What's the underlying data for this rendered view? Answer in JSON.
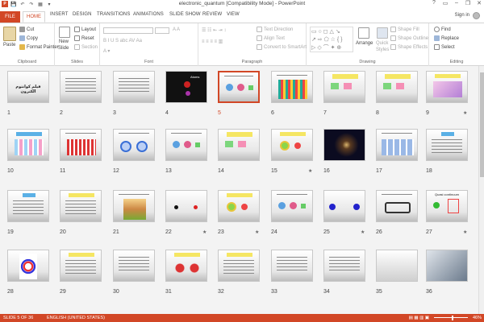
{
  "window": {
    "title": "electronic_quantum [Compatibility Mode] - PowerPoint",
    "controls": [
      "?",
      "▭",
      "–",
      "❐",
      "✕"
    ]
  },
  "qat": [
    "P",
    "💾",
    "↶",
    "↷",
    "▦",
    "▾"
  ],
  "tabs": {
    "file": "FILE",
    "home": "HOME",
    "items": [
      "INSERT",
      "DESIGN",
      "TRANSITIONS",
      "ANIMATIONS",
      "SLIDE SHOW",
      "REVIEW",
      "VIEW"
    ],
    "signin": "Sign in"
  },
  "ribbon": {
    "clipboard": {
      "label": "Clipboard",
      "paste": "Paste",
      "cut": "Cut",
      "copy": "Copy",
      "format_painter": "Format Painter"
    },
    "slides": {
      "label": "Slides",
      "new_slide": "New",
      "new_slide2": "Slide",
      "layout": "Layout",
      "reset": "Reset",
      "section": "Section"
    },
    "font": {
      "label": "Font"
    },
    "paragraph": {
      "label": "Paragraph",
      "text_direction": "Text Direction",
      "align_text": "Align Text",
      "convert": "Convert to SmartArt"
    },
    "drawing": {
      "label": "Drawing",
      "arrange": "Arrange",
      "quick_styles": "Quick",
      "quick_styles2": "Styles",
      "shape_fill": "Shape Fill",
      "shape_outline": "Shape Outline",
      "shape_effects": "Shape Effects"
    },
    "editing": {
      "label": "Editing",
      "find": "Find",
      "replace": "Replace",
      "select": "Select"
    }
  },
  "slides": [
    {
      "n": "1"
    },
    {
      "n": "2"
    },
    {
      "n": "3"
    },
    {
      "n": "4"
    },
    {
      "n": "5"
    },
    {
      "n": "6"
    },
    {
      "n": "7"
    },
    {
      "n": "8"
    },
    {
      "n": "9"
    },
    {
      "n": "10"
    },
    {
      "n": "11"
    },
    {
      "n": "12"
    },
    {
      "n": "13"
    },
    {
      "n": "14"
    },
    {
      "n": "15"
    },
    {
      "n": "16"
    },
    {
      "n": "17"
    },
    {
      "n": "18"
    },
    {
      "n": "19"
    },
    {
      "n": "20"
    },
    {
      "n": "21"
    },
    {
      "n": "22"
    },
    {
      "n": "23"
    },
    {
      "n": "24"
    },
    {
      "n": "25"
    },
    {
      "n": "26"
    },
    {
      "n": "27"
    },
    {
      "n": "28"
    },
    {
      "n": "29"
    },
    {
      "n": "30"
    },
    {
      "n": "31"
    },
    {
      "n": "32"
    },
    {
      "n": "33"
    },
    {
      "n": "34"
    },
    {
      "n": "35"
    },
    {
      "n": "36"
    }
  ],
  "slide_texts": {
    "s1": "فیلم کوانتوم الکترون",
    "s4": "Atoms",
    "s27": "Quasi continuum"
  },
  "selected_slide": "5",
  "starred_slides": [
    "9",
    "15",
    "22",
    "23",
    "25",
    "27"
  ],
  "status": {
    "slide": "SLIDE 5 OF 36",
    "lang": "ENGLISH (UNITED STATES)",
    "zoom": "46%"
  },
  "colors": {
    "accent": "#d24726"
  }
}
